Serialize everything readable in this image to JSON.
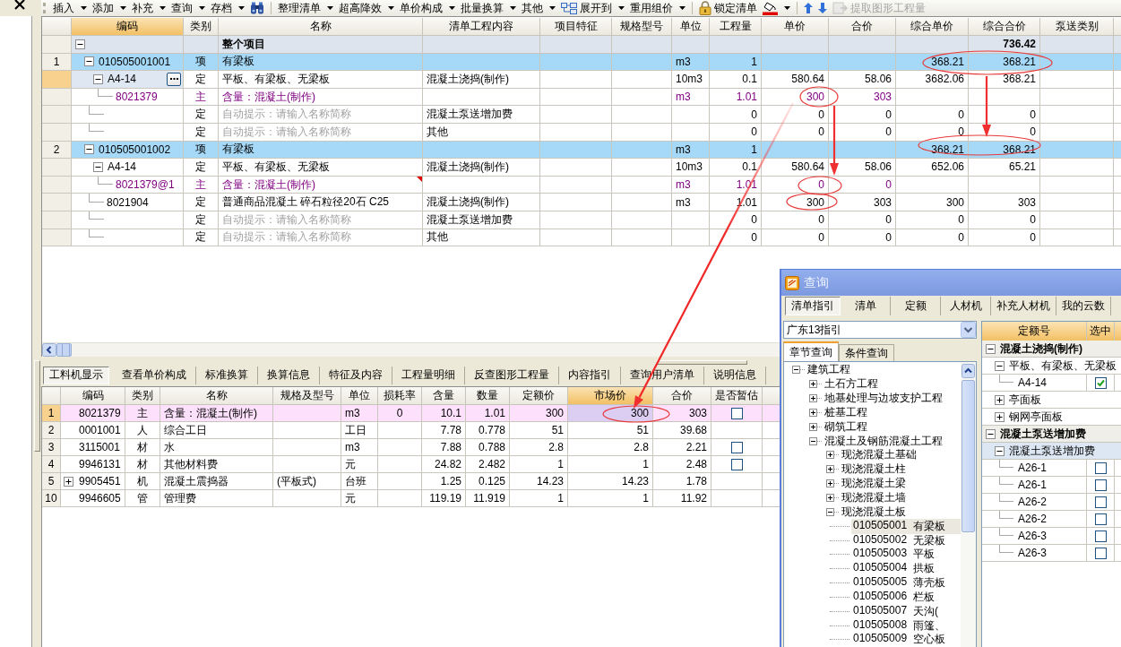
{
  "toolbar": {
    "groups": [
      [
        {
          "kind": "menu",
          "label": "插入",
          "dropdown": true,
          "disabled": false
        },
        {
          "kind": "menu",
          "label": "添加",
          "dropdown": true,
          "disabled": false
        },
        {
          "kind": "menu",
          "label": "补充",
          "dropdown": true,
          "disabled": false
        },
        {
          "kind": "menu",
          "label": "查询",
          "dropdown": true,
          "disabled": false
        },
        {
          "kind": "menu",
          "label": "存档",
          "dropdown": true,
          "disabled": false
        },
        {
          "kind": "icon",
          "dropdown": false,
          "disabled": false
        }
      ],
      [
        {
          "kind": "menu",
          "label": "整理清单",
          "dropdown": true,
          "disabled": false
        },
        {
          "kind": "menu",
          "label": "超高降效",
          "dropdown": true,
          "disabled": false
        },
        {
          "kind": "menu",
          "label": "单价构成",
          "dropdown": true,
          "disabled": false
        },
        {
          "kind": "menu",
          "label": "批量换算",
          "dropdown": true,
          "disabled": false
        },
        {
          "kind": "menu",
          "label": "其他",
          "dropdown": true,
          "disabled": false
        },
        {
          "kind": "icon",
          "label": "展开到",
          "dropdown": true,
          "disabled": false
        },
        {
          "kind": "menu",
          "label": "重用组价",
          "dropdown": true,
          "disabled": false
        }
      ],
      [
        {
          "kind": "icon",
          "label": "锁定清单",
          "dropdown": false,
          "disabled": false
        },
        {
          "kind": "icon",
          "dropdown": true,
          "disabled": false
        }
      ],
      [
        {
          "kind": "icon",
          "dropdown": false,
          "disabled": false
        },
        {
          "kind": "icon",
          "dropdown": false,
          "disabled": false
        },
        {
          "kind": "icon",
          "label": "提取图形工程量",
          "dropdown": false,
          "disabled": true
        }
      ]
    ]
  },
  "bill_grid": {
    "columns": [
      {
        "label": "编码",
        "selected": true
      },
      {
        "label": "类别",
        "selected": false
      },
      {
        "label": "名称",
        "selected": false
      },
      {
        "label": "清单工程内容",
        "selected": false
      },
      {
        "label": "项目特征",
        "selected": false
      },
      {
        "label": "规格型号",
        "selected": false
      },
      {
        "label": "单位",
        "selected": false
      },
      {
        "label": "工程量",
        "selected": false
      },
      {
        "label": "单价",
        "selected": false
      },
      {
        "label": "合价",
        "selected": false
      },
      {
        "label": "综合单价",
        "selected": false
      },
      {
        "label": "综合合价",
        "selected": false
      },
      {
        "label": "泵送类别",
        "selected": false
      }
    ],
    "rows": [
      {
        "kind": "root",
        "expanded": true,
        "selected": false,
        "modified": false,
        "name": "整个项目",
        "total": "736.42",
        "children": [
          {
            "num": "1",
            "kind": "bill",
            "expanded": true,
            "selected": false,
            "modified": false,
            "code": "010505001001",
            "type": "项",
            "name": "有梁板",
            "unit": "m3",
            "qty": "1",
            "unit_total": "368.21",
            "total": "368.21",
            "children": [
              {
                "kind": "quota",
                "expanded": true,
                "selected": true,
                "modified": false,
                "code": "A4-14",
                "type": "定",
                "name": "平板、有梁板、无梁板",
                "content": "混凝土浇捣(制作)",
                "unit": "10m3",
                "qty": "0.1",
                "price": "580.64",
                "amount": "58.06",
                "unit_total": "3682.06",
                "total": "368.21",
                "children": [
                  {
                    "kind": "material",
                    "selected": false,
                    "modified": false,
                    "code": "8021379",
                    "type": "主",
                    "name": "含量：混凝土(制作)",
                    "unit": "m3",
                    "qty": "1.01",
                    "price": "300",
                    "amount": "303"
                  }
                ]
              },
              {
                "kind": "hint",
                "selected": false,
                "modified": false,
                "type": "定",
                "name": "自动提示：请输入名称简称",
                "content": "混凝土泵送增加费",
                "qty": "0",
                "price": "0",
                "amount": "0",
                "unit_total": "0",
                "total": "0"
              },
              {
                "kind": "hint",
                "selected": false,
                "modified": false,
                "type": "定",
                "name": "自动提示：请输入名称简称",
                "content": "其他",
                "qty": "0",
                "price": "0",
                "amount": "0",
                "unit_total": "0",
                "total": "0"
              }
            ]
          },
          {
            "num": "2",
            "kind": "bill",
            "expanded": true,
            "selected": false,
            "modified": false,
            "code": "010505001002",
            "type": "项",
            "name": "有梁板",
            "unit": "m3",
            "qty": "1",
            "unit_total": "368.21",
            "total": "368.21",
            "children": [
              {
                "kind": "quota",
                "expanded": true,
                "selected": false,
                "modified": false,
                "code": "A4-14",
                "type": "定",
                "name": "平板、有梁板、无梁板",
                "content": "混凝土浇捣(制作)",
                "unit": "10m3",
                "qty": "0.1",
                "price": "580.64",
                "amount": "58.06",
                "unit_total": "652.06",
                "total": "65.21",
                "children": [
                  {
                    "kind": "material",
                    "selected": false,
                    "modified": true,
                    "code": "8021379@1",
                    "type": "主",
                    "name": "含量：混凝土(制作)",
                    "unit": "m3",
                    "qty": "1.01",
                    "price": "0",
                    "amount": "0"
                  }
                ]
              },
              {
                "kind": "quota",
                "selected": false,
                "modified": false,
                "code": "8021904",
                "type": "定",
                "name": "普通商品混凝土 碎石粒径20石 C25",
                "content": "混凝土浇捣(制作)",
                "unit": "m3",
                "qty": "1.01",
                "price": "300",
                "amount": "303",
                "unit_total": "300",
                "total": "303"
              },
              {
                "kind": "hint",
                "selected": false,
                "modified": false,
                "type": "定",
                "name": "自动提示：请输入名称简称",
                "content": "混凝土泵送增加费",
                "qty": "0",
                "price": "0",
                "amount": "0",
                "unit_total": "0",
                "total": "0"
              },
              {
                "kind": "hint",
                "selected": false,
                "modified": false,
                "type": "定",
                "name": "自动提示：请输入名称简称",
                "content": "其他",
                "qty": "0",
                "price": "0",
                "amount": "0",
                "unit_total": "0",
                "total": "0"
              }
            ]
          }
        ]
      }
    ]
  },
  "detail_tabs": [
    {
      "label": "工料机显示",
      "selected": true
    },
    {
      "label": "查看单价构成",
      "selected": false
    },
    {
      "label": "标准换算",
      "selected": false
    },
    {
      "label": "换算信息",
      "selected": false
    },
    {
      "label": "特征及内容",
      "selected": false
    },
    {
      "label": "工程量明细",
      "selected": false
    },
    {
      "label": "反查图形工程量",
      "selected": false
    },
    {
      "label": "内容指引",
      "selected": false
    },
    {
      "label": "查询用户清单",
      "selected": false
    },
    {
      "label": "说明信息",
      "selected": false
    }
  ],
  "resource_grid": {
    "columns": [
      {
        "label": "编码",
        "selected": false
      },
      {
        "label": "类别",
        "selected": false
      },
      {
        "label": "名称",
        "selected": false
      },
      {
        "label": "规格及型号",
        "selected": false
      },
      {
        "label": "单位",
        "selected": false
      },
      {
        "label": "损耗率",
        "selected": false
      },
      {
        "label": "含量",
        "selected": false
      },
      {
        "label": "数量",
        "selected": false
      },
      {
        "label": "定额价",
        "selected": false
      },
      {
        "label": "市场价",
        "selected": true
      },
      {
        "label": "合价",
        "selected": false
      },
      {
        "label": "是否暂估",
        "selected": false
      }
    ],
    "rows": [
      {
        "num": "1",
        "selected": true,
        "code": "8021379",
        "type": "主",
        "name": "含量：混凝土(制作)",
        "unit": "m3",
        "loss": "0",
        "content": "10.1",
        "qty": "1.01",
        "base_price": "300",
        "market_price": "300",
        "amount": "303",
        "estimated": false
      },
      {
        "num": "2",
        "selected": false,
        "code": "0001001",
        "type": "人",
        "name": "综合工日",
        "unit": "工日",
        "content": "7.78",
        "qty": "0.778",
        "base_price": "51",
        "market_price": "51",
        "amount": "39.68"
      },
      {
        "num": "3",
        "selected": false,
        "code": "3115001",
        "type": "材",
        "name": "水",
        "unit": "m3",
        "content": "7.88",
        "qty": "0.788",
        "base_price": "2.8",
        "market_price": "2.8",
        "amount": "2.21",
        "estimated": false
      },
      {
        "num": "4",
        "selected": false,
        "code": "9946131",
        "type": "材",
        "name": "其他材料费",
        "unit": "元",
        "content": "24.82",
        "qty": "2.482",
        "base_price": "1",
        "market_price": "1",
        "amount": "2.48",
        "estimated": false
      },
      {
        "num": "5",
        "selected": false,
        "expanded": false,
        "code": "9905451",
        "type": "机",
        "name": "混凝土震捣器",
        "spec": "(平板式)",
        "unit": "台班",
        "content": "1.25",
        "qty": "0.125",
        "base_price": "14.23",
        "market_price": "14.23",
        "amount": "1.78"
      },
      {
        "num": "10",
        "selected": false,
        "code": "9946605",
        "type": "管",
        "name": "管理费",
        "unit": "元",
        "content": "119.19",
        "qty": "11.919",
        "base_price": "1",
        "market_price": "1",
        "amount": "11.92"
      }
    ]
  },
  "query_dialog": {
    "title": "查询",
    "tabs": [
      {
        "label": "清单指引",
        "selected": true
      },
      {
        "label": "清单",
        "selected": false
      },
      {
        "label": "定额",
        "selected": false
      },
      {
        "label": "人材机",
        "selected": false
      },
      {
        "label": "补充人材机",
        "selected": false
      },
      {
        "label": "我的云数",
        "selected": false
      }
    ],
    "library": {
      "value": "广东13指引"
    },
    "search_tabs": [
      {
        "label": "章节查询",
        "selected": true
      },
      {
        "label": "条件查询",
        "selected": false
      }
    ],
    "chapter_tree": [
      {
        "label": "建筑工程",
        "expanded": true,
        "selected": false,
        "children": [
          {
            "label": "土石方工程",
            "expanded": false,
            "selected": false
          },
          {
            "label": "地基处理与边坡支护工程",
            "expanded": false,
            "selected": false
          },
          {
            "label": "桩基工程",
            "expanded": false,
            "selected": false
          },
          {
            "label": "砌筑工程",
            "expanded": false,
            "selected": false
          },
          {
            "label": "混凝土及钢筋混凝土工程",
            "expanded": true,
            "selected": false,
            "children": [
              {
                "label": "现浇混凝土基础",
                "expanded": false,
                "selected": false
              },
              {
                "label": "现浇混凝土柱",
                "expanded": false,
                "selected": false
              },
              {
                "label": "现浇混凝土梁",
                "expanded": false,
                "selected": false
              },
              {
                "label": "现浇混凝土墙",
                "expanded": false,
                "selected": false
              },
              {
                "label": "现浇混凝土板",
                "expanded": true,
                "selected": false,
                "children": [
                  {
                    "code": "010505001",
                    "label": "有梁板",
                    "selected": true
                  },
                  {
                    "code": "010505002",
                    "label": "无梁板",
                    "selected": false
                  },
                  {
                    "code": "010505003",
                    "label": "平板",
                    "selected": false
                  },
                  {
                    "code": "010505004",
                    "label": "拱板",
                    "selected": false
                  },
                  {
                    "code": "010505005",
                    "label": "薄壳板",
                    "selected": false
                  },
                  {
                    "code": "010505006",
                    "label": "栏板",
                    "selected": false
                  },
                  {
                    "code": "010505007",
                    "label": "天沟(",
                    "selected": false
                  },
                  {
                    "code": "010505008",
                    "label": "雨篷、",
                    "selected": false
                  },
                  {
                    "code": "010505009",
                    "label": "空心板",
                    "selected": false
                  }
                ]
              }
            ]
          }
        ]
      }
    ],
    "quota_table": {
      "columns": [
        {
          "label": "定额号"
        },
        {
          "label": "选中"
        }
      ],
      "groups": [
        {
          "label": "混凝土浇捣(制作)",
          "expanded": true,
          "children": [
            {
              "label": "平板、有梁板、无梁板",
              "expanded": true,
              "selected": false,
              "children": [
                {
                  "code": "A4-14",
                  "checked": true
                }
              ]
            },
            {
              "label": "亭面板",
              "expanded": false,
              "selected": false
            },
            {
              "label": "钢网亭面板",
              "expanded": false,
              "selected": false
            }
          ]
        },
        {
          "label": "混凝土泵送增加费",
          "expanded": true,
          "children": [
            {
              "label": "混凝土泵送增加费",
              "expanded": true,
              "selected": true,
              "children": [
                {
                  "code": "A26-1",
                  "checked": false
                },
                {
                  "code": "A26-1",
                  "checked": false
                },
                {
                  "code": "A26-2",
                  "checked": false
                },
                {
                  "code": "A26-2",
                  "checked": false
                },
                {
                  "code": "A26-3",
                  "checked": false
                },
                {
                  "code": "A26-3",
                  "checked": false
                }
              ]
            }
          ]
        }
      ]
    }
  },
  "annotations": [
    {
      "kind": "ellipse"
    },
    {
      "kind": "ellipse"
    },
    {
      "kind": "ellipse"
    },
    {
      "kind": "ellipse"
    },
    {
      "kind": "ellipse"
    },
    {
      "kind": "ellipse"
    },
    {
      "kind": "arrow"
    },
    {
      "kind": "arrow"
    },
    {
      "kind": "arrow"
    }
  ]
}
